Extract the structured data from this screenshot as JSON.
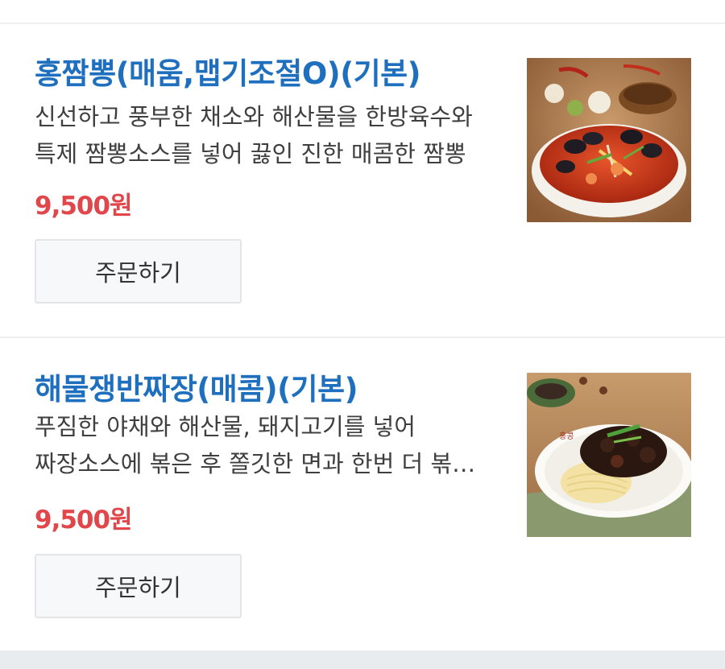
{
  "menu": {
    "items": [
      {
        "name": "홍짬뽕(매움,맵기조절O)(기본)",
        "description": "신선하고 풍부한 채소와 해산물을 한방육수와 특제 짬뽕소스를 넣어 끓인 진한 매콤한 짬뽕",
        "price": "9,500원",
        "order_label": "주문하기",
        "image_icon": "jjamppong-photo"
      },
      {
        "name": "해물쟁반짜장(매콤)(기본)",
        "description": "푸짐한 야채와 해산물, 돼지고기를 넣어 짜장소스에 볶은 후 쫄깃한 면과 한번 더 볶아낸 쟁반짜장",
        "price": "9,500원",
        "order_label": "주문하기",
        "image_icon": "jajangmyeon-photo"
      }
    ]
  },
  "colors": {
    "title": "#1f6fbf",
    "price": "#e0464a",
    "button_bg": "#f7f8fa",
    "divider": "#eef0f2"
  }
}
